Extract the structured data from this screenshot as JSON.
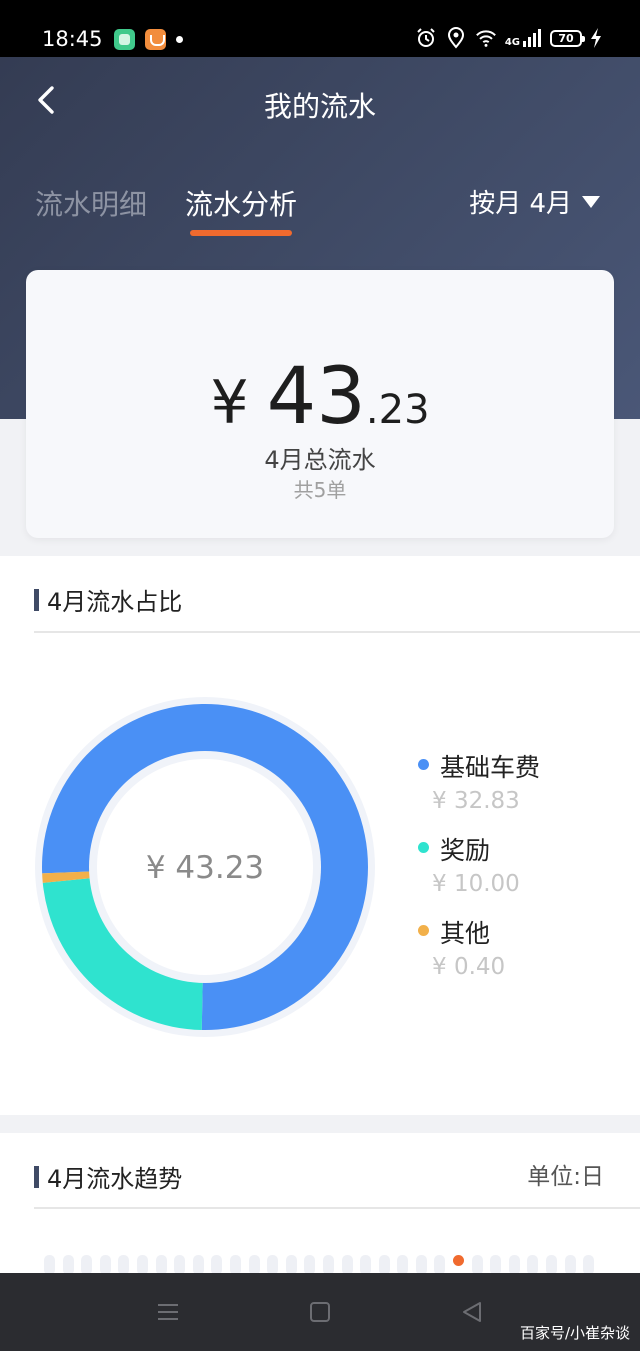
{
  "status_bar": {
    "time": "18:45",
    "network": "4G",
    "battery": "70"
  },
  "header": {
    "title": "我的流水",
    "tabs": [
      {
        "label": "流水明细",
        "active": false
      },
      {
        "label": "流水分析",
        "active": true
      }
    ],
    "period_selector": "按月 4月",
    "accent_color": "#f06a2e"
  },
  "summary": {
    "currency": "¥",
    "amount_int": "43",
    "amount_dec": ".23",
    "label": "4月总流水",
    "count": "共5单"
  },
  "pie_section": {
    "title": "4月流水占比",
    "center_label": "¥ 43.23",
    "chart_data": {
      "type": "pie",
      "total": 43.23,
      "slices": [
        {
          "name": "基础车费",
          "value": 32.83,
          "value_label": "¥ 32.83",
          "color": "#4a90f5"
        },
        {
          "name": "奖励",
          "value": 10.0,
          "value_label": "¥ 10.00",
          "color": "#2fe3cf"
        },
        {
          "name": "其他",
          "value": 0.4,
          "value_label": "¥ 0.40",
          "color": "#f2b04a"
        }
      ]
    }
  },
  "trend_section": {
    "title": "4月流水趋势",
    "unit": "单位:日"
  },
  "nav_bar": {
    "icons": [
      "menu-icon",
      "home-icon",
      "back-triangle-icon"
    ]
  },
  "watermark": "百家号/小崔杂谈"
}
